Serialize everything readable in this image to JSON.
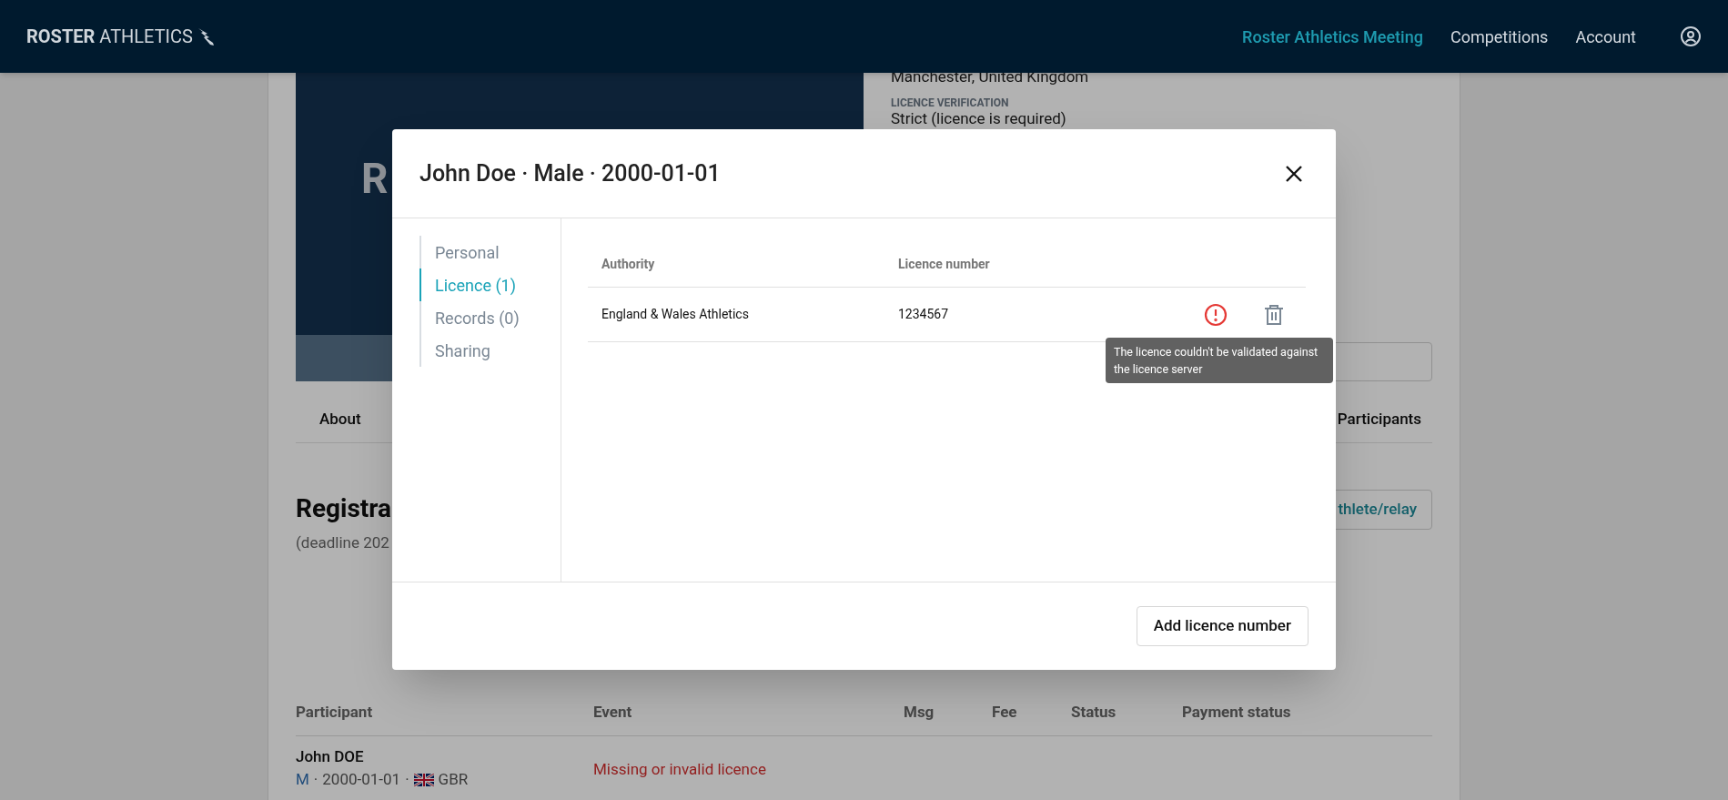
{
  "header": {
    "brand_bold": "ROSTER",
    "brand_light": "ATHLETICS",
    "nav": [
      {
        "label": "Roster Athletics Meeting",
        "selected": true
      },
      {
        "label": "Competitions",
        "selected": false
      },
      {
        "label": "Account",
        "selected": false
      }
    ]
  },
  "background": {
    "hero_text": "R",
    "location": "Manchester, United Kingdom",
    "verification_label": "LICENCE VERIFICATION",
    "verification_value": "Strict (licence is required)",
    "tabs": [
      "About",
      "Participants"
    ],
    "registration_title": "Registra",
    "deadline": "(deadline 202",
    "add_button": "thlete/relay",
    "table": {
      "columns": [
        "Participant",
        "Event",
        "Msg",
        "Fee",
        "Status",
        "Payment status"
      ],
      "rows": [
        {
          "name": "John DOE",
          "gender": "M",
          "birthdate": "2000-01-01",
          "country": "GBR",
          "separator": "·",
          "event": "Missing or invalid licence"
        }
      ]
    }
  },
  "modal": {
    "title": "John Doe · Male · 2000-01-01",
    "nav": [
      {
        "label": "Personal",
        "selected": false
      },
      {
        "label": "Licence (1)",
        "selected": true
      },
      {
        "label": "Records (0)",
        "selected": false
      },
      {
        "label": "Sharing",
        "selected": false
      }
    ],
    "table": {
      "columns": [
        "Authority",
        "Licence number"
      ],
      "rows": [
        {
          "authority": "England & Wales Athletics",
          "number": "1234567",
          "invalid": true
        }
      ]
    },
    "tooltip": "The licence couldn't be validated against the licence server",
    "footer_button": "Add licence number"
  }
}
